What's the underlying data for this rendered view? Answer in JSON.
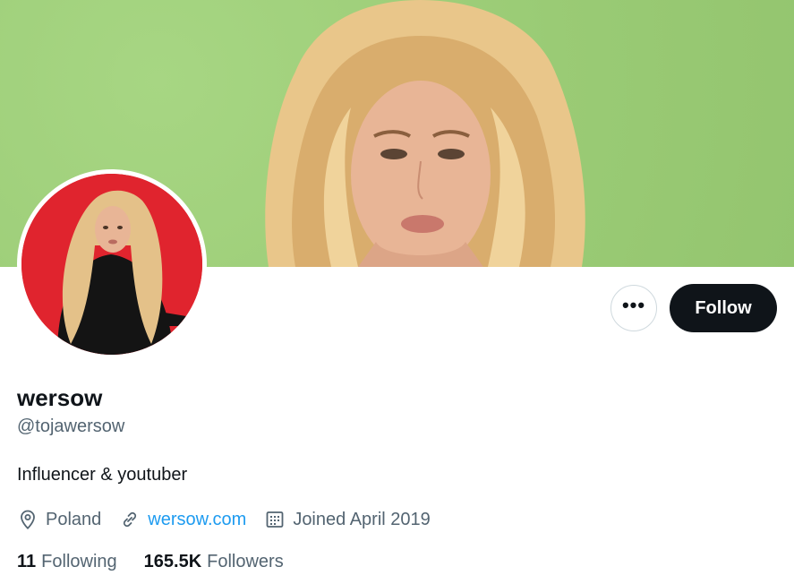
{
  "profile": {
    "name": "wersow",
    "handle": "@tojawersow",
    "bio": "Influencer & youtuber",
    "location": "Poland",
    "website": "wersow.com",
    "joined": "Joined April 2019"
  },
  "actions": {
    "more_label": "•••",
    "follow_label": "Follow"
  },
  "stats": {
    "following_count": "11",
    "following_label": "Following",
    "followers_count": "165.5K",
    "followers_label": "Followers"
  },
  "icons": {
    "location": "location-pin-icon",
    "link": "link-icon",
    "calendar": "calendar-icon"
  },
  "colors": {
    "banner_bg": "#9fd07a",
    "avatar_bg": "#e0242e",
    "follow_bg": "#0f1419",
    "link": "#1d9bf0",
    "muted": "#536471"
  }
}
